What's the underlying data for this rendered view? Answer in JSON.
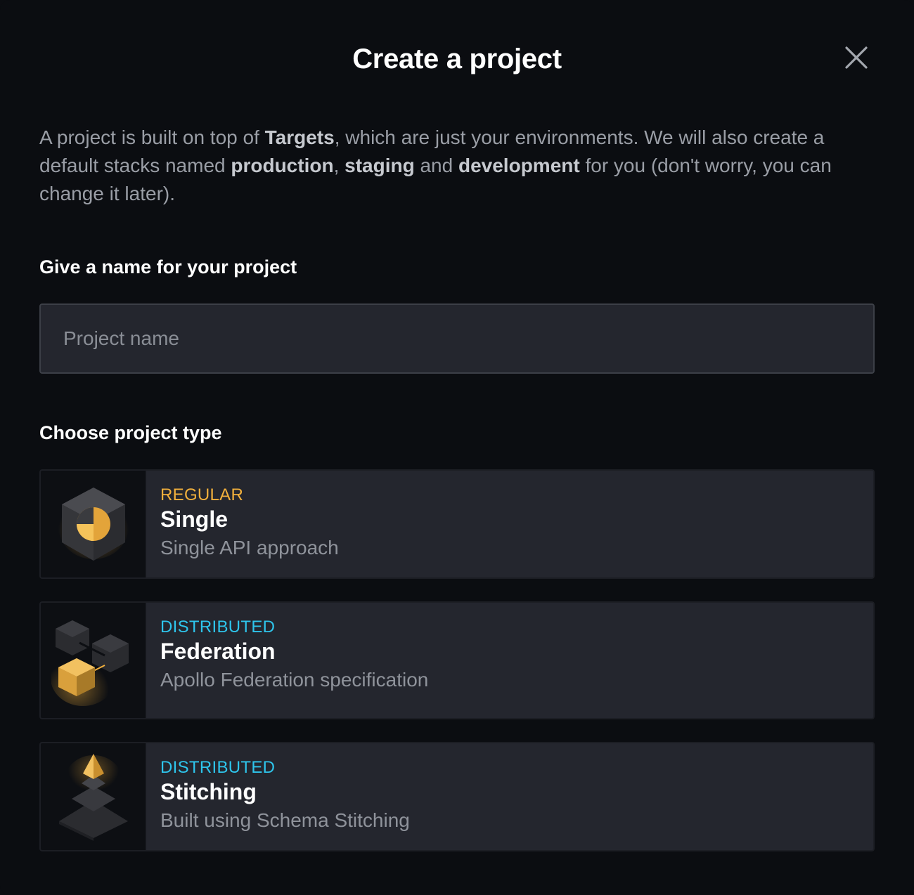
{
  "dialog": {
    "title": "Create a project",
    "description": [
      {
        "text": "A project is built on top of ",
        "bold": false
      },
      {
        "text": "Targets",
        "bold": true
      },
      {
        "text": ", which are just your environments. We will also create a default stacks named ",
        "bold": false
      },
      {
        "text": "production",
        "bold": true
      },
      {
        "text": ", ",
        "bold": false
      },
      {
        "text": "staging",
        "bold": true
      },
      {
        "text": " and ",
        "bold": false
      },
      {
        "text": "development",
        "bold": true
      },
      {
        "text": " for you (don't worry, you can change it later).",
        "bold": false
      }
    ]
  },
  "name_section": {
    "label": "Give a name for your project",
    "input_value": "",
    "placeholder": "Project name"
  },
  "type_section": {
    "label": "Choose project type",
    "types": [
      {
        "kind": "REGULAR",
        "kind_color": "#f2b03c",
        "name": "Single",
        "description": "Single API approach",
        "icon": "cube-icon"
      },
      {
        "kind": "DISTRIBUTED",
        "kind_color": "#2ec5ec",
        "name": "Federation",
        "description": "Apollo Federation specification",
        "icon": "cubes-icon"
      },
      {
        "kind": "DISTRIBUTED",
        "kind_color": "#2ec5ec",
        "name": "Stitching",
        "description": "Built using Schema Stitching",
        "icon": "pyramid-icon"
      }
    ]
  },
  "colors": {
    "background": "#0b0d11",
    "card": "#24262e",
    "regular_accent": "#f2b03c",
    "distributed_accent": "#2ec5ec"
  }
}
